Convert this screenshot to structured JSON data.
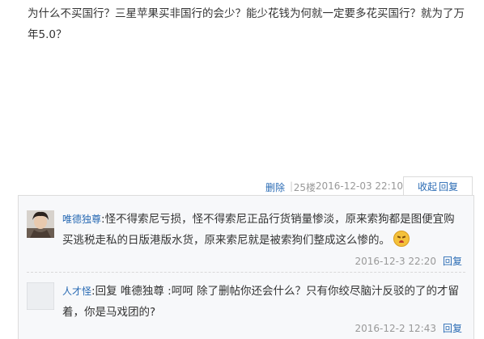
{
  "post": {
    "text": "为什么不买国行？三星苹果买非国行的会少？能少花钱为何就一定要多花买国行？就为了万年5.0？"
  },
  "meta": {
    "delete_label": "删除",
    "separator": "|",
    "floor": "25楼",
    "timestamp": "2016-12-03 22:10",
    "collapse_label": "收起",
    "reply_label": "回复"
  },
  "replies": [
    {
      "avatar_icon": "user-photo-icon",
      "username": "唯德独尊",
      "colon": ":",
      "text": "怪不得索尼亏损，怪不得索尼正品行货销量惨淡，原来索狗都是图便宜购买逃税走私的日版港版水货，原来索尼就是被索狗们整成这么惨的。",
      "emoji": "angry-face-icon",
      "timestamp": "2016-12-3 22:20",
      "reply_label": "回复"
    },
    {
      "avatar_icon": "default-avatar-icon",
      "username": "人才怪",
      "text": ":回复 唯德独尊 :呵呵 除了删帖你还会什么？只有你绞尽脑汁反驳的了的才留着，你是马戏团的?",
      "timestamp": "2016-12-2 12:43",
      "reply_label": "回复"
    }
  ],
  "colors": {
    "link": "#2a6bb4",
    "muted": "#999999",
    "panel_bg": "#f7f8fa",
    "border": "#dcdcdc"
  }
}
